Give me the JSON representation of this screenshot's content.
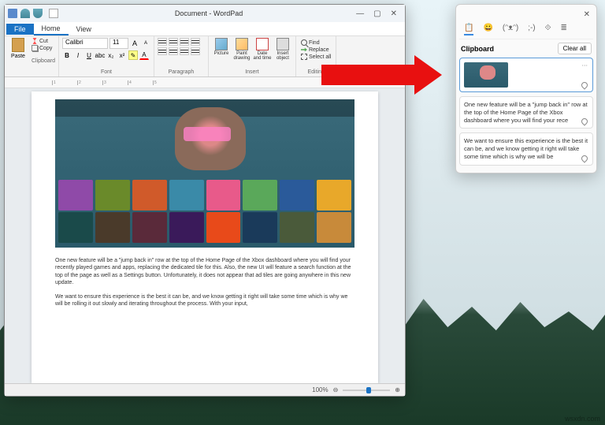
{
  "wordpad": {
    "title": "Document - WordPad",
    "tabs": {
      "file": "File",
      "home": "Home",
      "view": "View"
    },
    "clipboard": {
      "label": "Clipboard",
      "paste": "Paste",
      "cut": "Cut",
      "copy": "Copy"
    },
    "font": {
      "label": "Font",
      "family": "Calibri",
      "size": "11"
    },
    "paragraph": {
      "label": "Paragraph"
    },
    "insert": {
      "label": "Insert",
      "picture": "Picture",
      "paint": "Paint drawing",
      "date": "Date and time",
      "object": "Insert object"
    },
    "editing": {
      "label": "Editing",
      "find": "Find",
      "replace": "Replace",
      "select": "Select all"
    },
    "ruler_marks": [
      "1",
      "2",
      "3",
      "4",
      "5"
    ],
    "doc": {
      "p1": "One new feature will be a \"jump back in\" row at the top of the Home Page of the Xbox dashboard where you will find your recently played games and apps, replacing the dedicated tile for this. Also, the new UI will feature a search function at the top of the page as well as a Settings button. Unfortunately, it does not appear that ad tiles are going anywhere in this new update.",
      "p2": "We want to ensure this experience is the best it can be, and we know getting it right will take some time which is why we will be rolling it out slowly and iterating throughout the process. With your input,"
    },
    "zoom": "100%"
  },
  "clipboard_panel": {
    "title": "Clipboard",
    "tab_icons": [
      "📋",
      "😀",
      "(ᵔᴥᵔ)",
      ";-)",
      "⟐",
      "≣"
    ],
    "clear": "Clear all",
    "items": [
      {
        "type": "image"
      },
      {
        "type": "text",
        "text": "One new feature will be a \"jump back in\" row at the top of the Home Page of the Xbox dashboard where you will find your rece"
      },
      {
        "type": "text",
        "text": "We want to ensure this experience is the best it can be, and we know getting it right will take some time which is why we will be"
      }
    ]
  },
  "watermark": "wsxdn.com"
}
